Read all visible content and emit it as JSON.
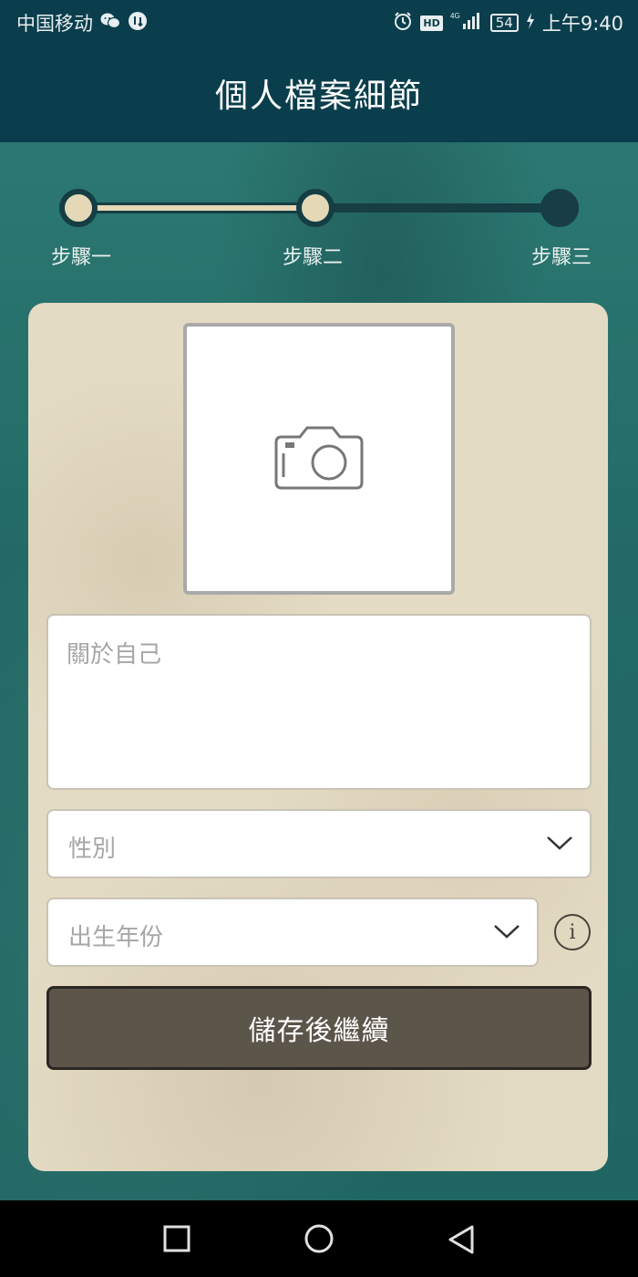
{
  "status_bar": {
    "carrier": "中国移动",
    "network": "4G",
    "battery": "54",
    "time": "上午9:40",
    "hd_badge": "HD",
    "icons": [
      "wechat-icon",
      "download-badge-icon",
      "alarm-icon",
      "hd-icon",
      "signal-icon",
      "battery-icon",
      "charging-icon"
    ]
  },
  "header": {
    "title": "個人檔案細節"
  },
  "stepper": {
    "steps": [
      {
        "label": "步驟一",
        "state": "completed"
      },
      {
        "label": "步驟二",
        "state": "current"
      },
      {
        "label": "步驟三",
        "state": "pending"
      }
    ]
  },
  "form": {
    "photo": {
      "icon": "camera-icon"
    },
    "about": {
      "placeholder": "關於自己"
    },
    "gender": {
      "placeholder": "性別",
      "icon": "chevron-down-icon"
    },
    "birth_year": {
      "placeholder": "出生年份",
      "icon": "chevron-down-icon"
    },
    "info": {
      "icon": "info-icon",
      "glyph": "i"
    },
    "submit_label": "儲存後繼續"
  },
  "nav_bar": {
    "icons": [
      "recents-square-icon",
      "home-circle-icon",
      "back-triangle-icon"
    ]
  },
  "colors": {
    "header_bg": "#0a3e4c",
    "page_bg": "#236a66",
    "card_bg": "#e4dbc4",
    "step_active": "#e5d8b7",
    "step_inactive": "#163e44",
    "button_bg": "#5c554a"
  }
}
